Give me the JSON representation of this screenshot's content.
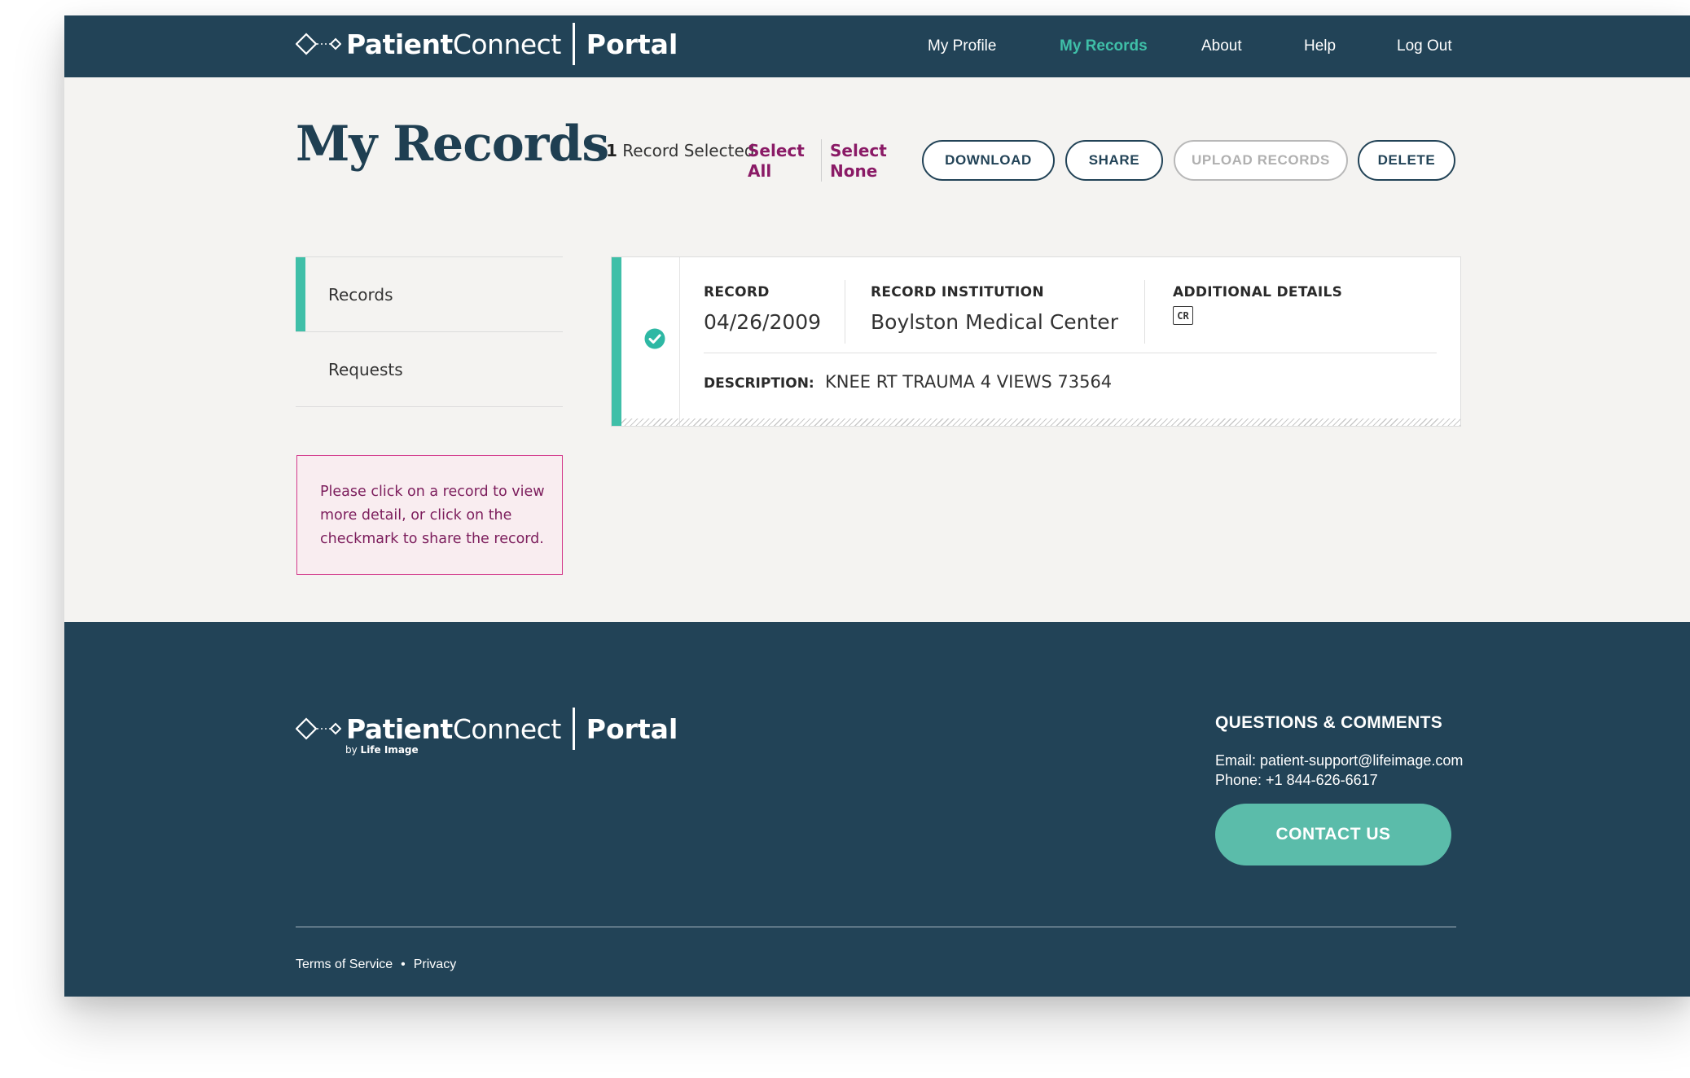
{
  "header": {
    "brand_bold": "Patient",
    "brand_light": "Connect",
    "portal": "Portal",
    "nav": [
      {
        "label": "My Profile",
        "active": false
      },
      {
        "label": "My Records",
        "active": true
      },
      {
        "label": "About",
        "active": false
      },
      {
        "label": "Help",
        "active": false
      },
      {
        "label": "Log Out",
        "active": false
      }
    ]
  },
  "page": {
    "title": "My Records",
    "selection": {
      "count": "1",
      "count_label": "Record Selected",
      "select_all_line1": "Select",
      "select_all_line2": "All",
      "select_none_line1": "Select",
      "select_none_line2": "None"
    },
    "actions": {
      "download": "DOWNLOAD",
      "share": "SHARE",
      "upload": "UPLOAD RECORDS",
      "delete": "DELETE"
    }
  },
  "sidebar": {
    "items": [
      {
        "label": "Records",
        "active": true
      },
      {
        "label": "Requests",
        "active": false
      }
    ],
    "help_text": "Please click on a record to view more detail, or click on the checkmark to share the record."
  },
  "record": {
    "selected": true,
    "col_record": "RECORD",
    "col_institution": "RECORD INSTITUTION",
    "col_details": "ADDITIONAL DETAILS",
    "date": "04/26/2009",
    "institution": "Boylston Medical Center",
    "detail_badge": "CR",
    "description_label": "DESCRIPTION:",
    "description": "KNEE RT TRAUMA 4 VIEWS 73564"
  },
  "footer": {
    "by_prefix": "by",
    "by_brand": "Life Image",
    "qc_title": "QUESTIONS & COMMENTS",
    "email": "Email: patient-support@lifeimage.com",
    "phone": "Phone: +1 844-626-6617",
    "contact_label": "CONTACT US",
    "terms": "Terms of Service",
    "bullet": "•",
    "privacy": "Privacy"
  },
  "colors": {
    "navy": "#224357",
    "teal": "#3fbfa8",
    "magenta": "#8a1a66",
    "background": "#f4f3f1"
  }
}
